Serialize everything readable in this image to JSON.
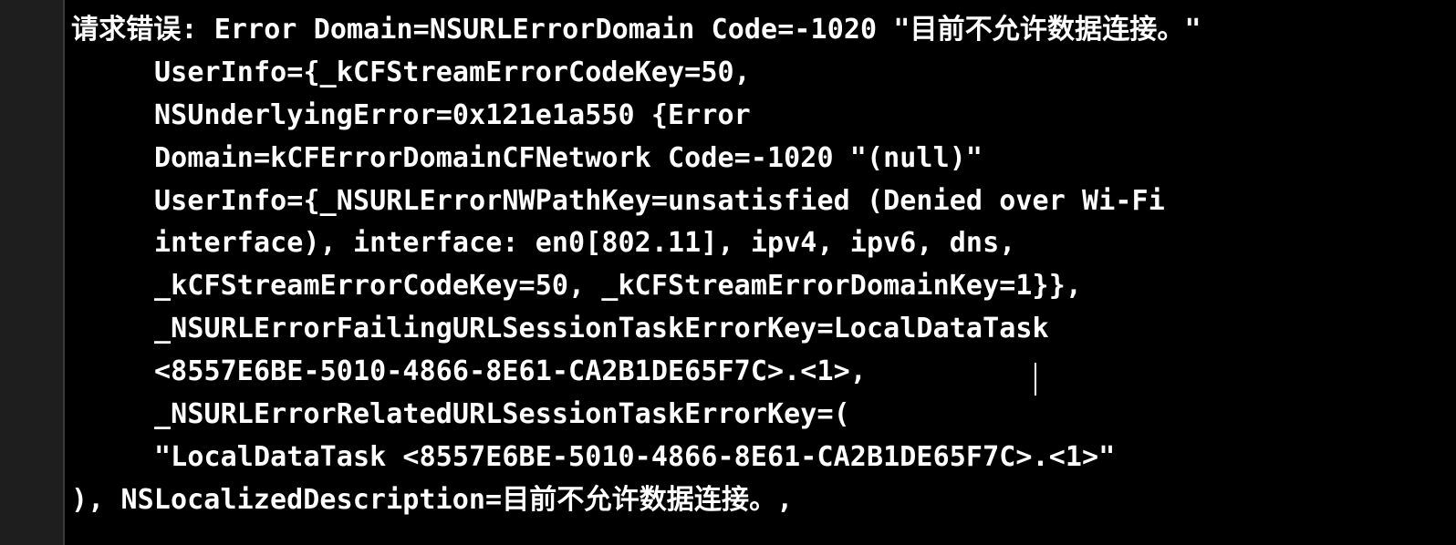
{
  "console": {
    "lines": [
      "请求错误: Error Domain=NSURLErrorDomain Code=-1020 \"目前不允许数据连接。\"",
      "UserInfo={_kCFStreamErrorCodeKey=50,",
      "NSUnderlyingError=0x121e1a550 {Error",
      "Domain=kCFErrorDomainCFNetwork Code=-1020 \"(null)\"",
      "UserInfo={_NSURLErrorNWPathKey=unsatisfied (Denied over Wi-Fi",
      "interface), interface: en0[802.11], ipv4, ipv6, dns,",
      "_kCFStreamErrorCodeKey=50, _kCFStreamErrorDomainKey=1}},",
      "_NSURLErrorFailingURLSessionTaskErrorKey=LocalDataTask",
      "<8557E6BE-5010-4866-8E61-CA2B1DE65F7C>.<1>,",
      "_NSURLErrorRelatedURLSessionTaskErrorKey=(",
      "\"LocalDataTask <8557E6BE-5010-4866-8E61-CA2B1DE65F7C>.<1>\"",
      "), NSLocalizedDescription=目前不允许数据连接。,"
    ]
  },
  "colors": {
    "background": "#000000",
    "text": "#ffffff",
    "gutter": "#1e1e1e"
  }
}
